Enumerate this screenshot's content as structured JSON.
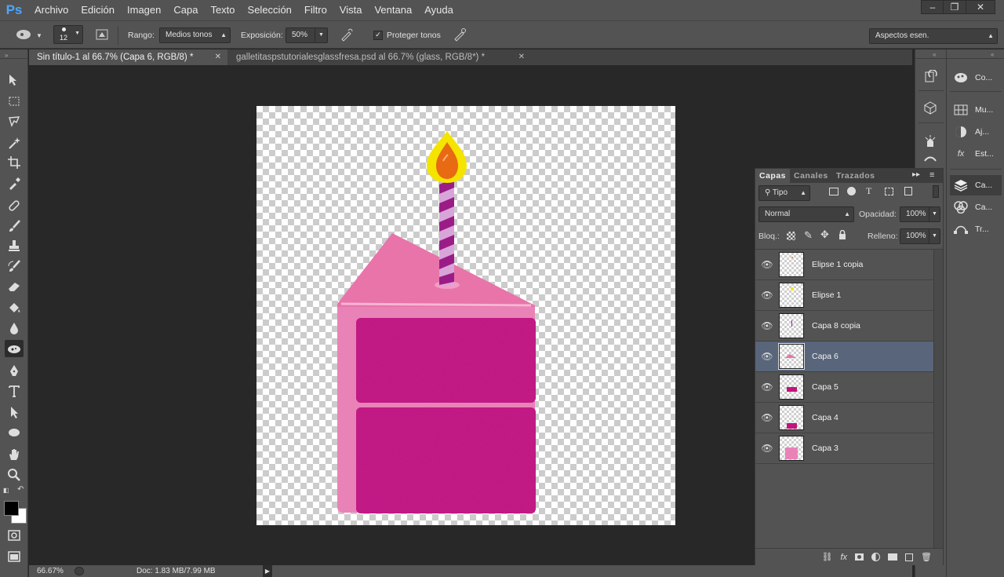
{
  "app": {
    "logo": "Ps"
  },
  "menu": [
    "Archivo",
    "Edición",
    "Imagen",
    "Capa",
    "Texto",
    "Selección",
    "Filtro",
    "Vista",
    "Ventana",
    "Ayuda"
  ],
  "options": {
    "brush_size": "12",
    "range_label": "Rango:",
    "range_value": "Medios tonos",
    "exposure_label": "Exposición:",
    "exposure_value": "50%",
    "protect_label": "Proteger tonos",
    "workspace_value": "Aspectos esen."
  },
  "tabs": [
    {
      "label": "Sin título-1 al 66.7% (Capa 6, RGB/8) *",
      "active": true
    },
    {
      "label": "galletitaspstutorialesglassfresa.psd al 66.7% (glass, RGB/8*) *",
      "active": false
    }
  ],
  "status": {
    "zoom": "66.67%",
    "doc": "Doc: 1.83 MB/7.99 MB"
  },
  "dock_icons": [
    "history-icon",
    "3d-icon",
    "tool-presets-icon",
    "brush-icon"
  ],
  "dock_panels": [
    {
      "icon": "color-icon",
      "label": "Co..."
    },
    {
      "icon": "swatches-icon",
      "label": "Mu..."
    },
    {
      "icon": "adjustments-icon",
      "label": "Aj..."
    },
    {
      "icon": "styles-icon",
      "label": "Est..."
    },
    {
      "icon": "layers-icon",
      "label": "Ca..."
    },
    {
      "icon": "channels-icon",
      "label": "Ca..."
    },
    {
      "icon": "paths-icon",
      "label": "Tr..."
    }
  ],
  "layers_panel": {
    "tabs": [
      "Capas",
      "Canales",
      "Trazados"
    ],
    "filter": "Tipo",
    "blend_mode": "Normal",
    "opacity_label": "Opacidad:",
    "opacity_value": "100%",
    "lock_label": "Bloq.:",
    "fill_label": "Relleno:",
    "fill_value": "100%",
    "layers": [
      {
        "name": "Elipse 1 copia",
        "visible": true,
        "selected": false
      },
      {
        "name": "Elipse 1",
        "visible": true,
        "selected": false
      },
      {
        "name": "Capa 8 copia",
        "visible": true,
        "selected": false
      },
      {
        "name": "Capa 6",
        "visible": true,
        "selected": true
      },
      {
        "name": "Capa 5",
        "visible": true,
        "selected": false
      },
      {
        "name": "Capa 4",
        "visible": true,
        "selected": false
      },
      {
        "name": "Capa 3",
        "visible": true,
        "selected": false
      }
    ]
  },
  "colors": {
    "foreground": "#000000",
    "background": "#ffffff",
    "cake_pink": "#e875ac",
    "cake_magenta": "#c0157a",
    "selected_layer": "#58657a"
  }
}
